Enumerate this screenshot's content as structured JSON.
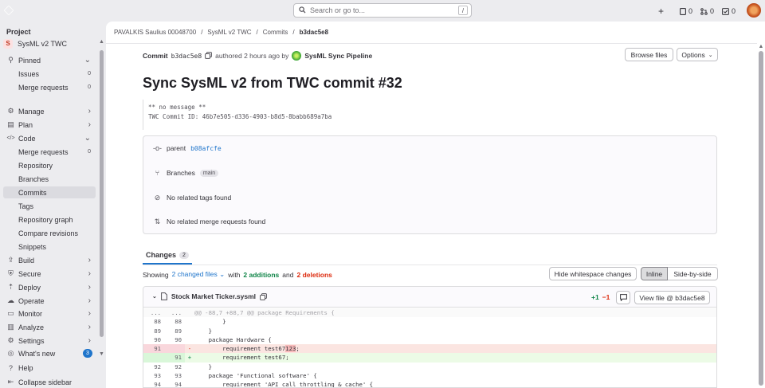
{
  "topbar": {
    "search_placeholder": "Search or go to...",
    "search_kbd": "/",
    "plus": "+",
    "issues_count": "0",
    "mrs_count": "0",
    "todos_count": "0"
  },
  "sidebar": {
    "heading": "Project",
    "project_initial": "S",
    "project_name": "SysML v2 TWC",
    "items": [
      {
        "label": "Pinned",
        "icon": "pin-icon",
        "right": "⌄"
      },
      {
        "label": "Issues",
        "sub": true,
        "right": "0"
      },
      {
        "label": "Merge requests",
        "sub": true,
        "right": "0"
      },
      {
        "label": "Manage",
        "icon": "users-icon",
        "right": "›"
      },
      {
        "label": "Plan",
        "icon": "plan-icon",
        "right": "›"
      },
      {
        "label": "Code",
        "icon": "code-icon",
        "right": "⌄"
      },
      {
        "label": "Merge requests",
        "sub": true,
        "right": "0"
      },
      {
        "label": "Repository",
        "sub": true,
        "right": ""
      },
      {
        "label": "Branches",
        "sub": true,
        "right": ""
      },
      {
        "label": "Commits",
        "sub": true,
        "right": "",
        "active": true
      },
      {
        "label": "Tags",
        "sub": true,
        "right": ""
      },
      {
        "label": "Repository graph",
        "sub": true,
        "right": ""
      },
      {
        "label": "Compare revisions",
        "sub": true,
        "right": ""
      },
      {
        "label": "Snippets",
        "sub": true,
        "right": ""
      },
      {
        "label": "Build",
        "icon": "rocket-icon",
        "right": "›"
      },
      {
        "label": "Secure",
        "icon": "shield-icon",
        "right": "›"
      },
      {
        "label": "Deploy",
        "icon": "deploy-icon",
        "right": "›"
      },
      {
        "label": "Operate",
        "icon": "cloud-icon",
        "right": "›"
      },
      {
        "label": "Monitor",
        "icon": "monitor-icon",
        "right": "›"
      },
      {
        "label": "Analyze",
        "icon": "chart-icon",
        "right": "›"
      },
      {
        "label": "Settings",
        "icon": "gear-icon",
        "right": "›"
      }
    ],
    "whats_new": "What's new",
    "whats_new_count": "3",
    "help": "Help",
    "collapse": "Collapse sidebar"
  },
  "breadcrumbs": [
    "PAVALKIS Saulius 00048700",
    "SysML v2 TWC",
    "Commits",
    "b3dac5e8"
  ],
  "commit": {
    "prefix": "Commit",
    "sha": "b3dac5e8",
    "authored": "authored 2 hours ago by",
    "author": "SysML Sync Pipeline",
    "browse_files": "Browse files",
    "options": "Options",
    "title": "Sync SysML v2 from TWC commit #32",
    "message_line1": "** no message **",
    "message_line2": "TWC Commit ID: 46b7e505-d336-4903-b8d5-8babb689a7ba",
    "parent_label": "parent",
    "parent_sha": "b08afcfe",
    "branches_label": "Branches",
    "branch_name": "main",
    "tags_text": "No related tags found",
    "mrs_text": "No related merge requests found"
  },
  "changes": {
    "tab_label": "Changes",
    "tab_count": "2",
    "showing": "Showing",
    "changed_files": "2 changed files",
    "with": "with",
    "additions": "2 additions",
    "and": "and",
    "deletions": "2 deletions",
    "hide_whitespace": "Hide whitespace changes",
    "inline": "Inline",
    "side_by_side": "Side-by-side"
  },
  "file": {
    "name": "Stock Market Ticker.sysml",
    "added": "+1",
    "removed": "−1",
    "view_file": "View file @ b3dac5e8",
    "lines": [
      {
        "t": "hunk",
        "n1": "...",
        "n2": "...",
        "s": "",
        "code": "@@ -88,7 +88,7 @@ package Requirements {"
      },
      {
        "t": "ctx",
        "n1": "88",
        "n2": "88",
        "s": "",
        "code": "        }"
      },
      {
        "t": "ctx",
        "n1": "89",
        "n2": "89",
        "s": "",
        "code": "    }"
      },
      {
        "t": "ctx",
        "n1": "90",
        "n2": "90",
        "s": "",
        "code": "    package Hardware {"
      },
      {
        "t": "del",
        "n1": "91",
        "n2": "",
        "s": "-",
        "code": "        requirement test67",
        "hl": "123",
        "tail": ";"
      },
      {
        "t": "add",
        "n1": "",
        "n2": "91",
        "s": "+",
        "code": "        requirement test67;"
      },
      {
        "t": "ctx",
        "n1": "92",
        "n2": "92",
        "s": "",
        "code": "    }"
      },
      {
        "t": "ctx",
        "n1": "93",
        "n2": "93",
        "s": "",
        "code": "    package 'Functional software' {"
      },
      {
        "t": "ctx",
        "n1": "94",
        "n2": "94",
        "s": "",
        "code": "        requirement 'API call throttling & cache' {"
      }
    ]
  }
}
